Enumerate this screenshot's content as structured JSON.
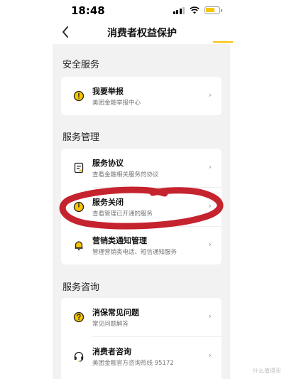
{
  "status_bar": {
    "time": "18:48"
  },
  "nav": {
    "title": "消费者权益保护"
  },
  "sections": [
    {
      "title": "安全服务",
      "items": [
        {
          "title": "我要举报",
          "subtitle": "美团金融举报中心",
          "icon": "alert-circle-icon"
        }
      ]
    },
    {
      "title": "服务管理",
      "items": [
        {
          "title": "服务协议",
          "subtitle": "查看金融相关服务的协议",
          "icon": "document-icon"
        },
        {
          "title": "服务关闭",
          "subtitle": "查看管理已开通的服务",
          "icon": "power-icon"
        },
        {
          "title": "营销类通知管理",
          "subtitle": "管理营销类电话、短信通知服务",
          "icon": "bell-icon"
        }
      ]
    },
    {
      "title": "服务咨询",
      "items": [
        {
          "title": "消保常见问题",
          "subtitle": "常见问题解答",
          "icon": "question-icon"
        },
        {
          "title": "消费者咨询",
          "subtitle": "美团金融官方咨询热线 95172",
          "icon": "headset-icon"
        }
      ]
    }
  ],
  "chevron_glyph": "›",
  "watermark": "什么值得买",
  "colors": {
    "accent": "#f7c500",
    "annotation": "#c0101c",
    "panel_bg": "#f2f2f2"
  }
}
